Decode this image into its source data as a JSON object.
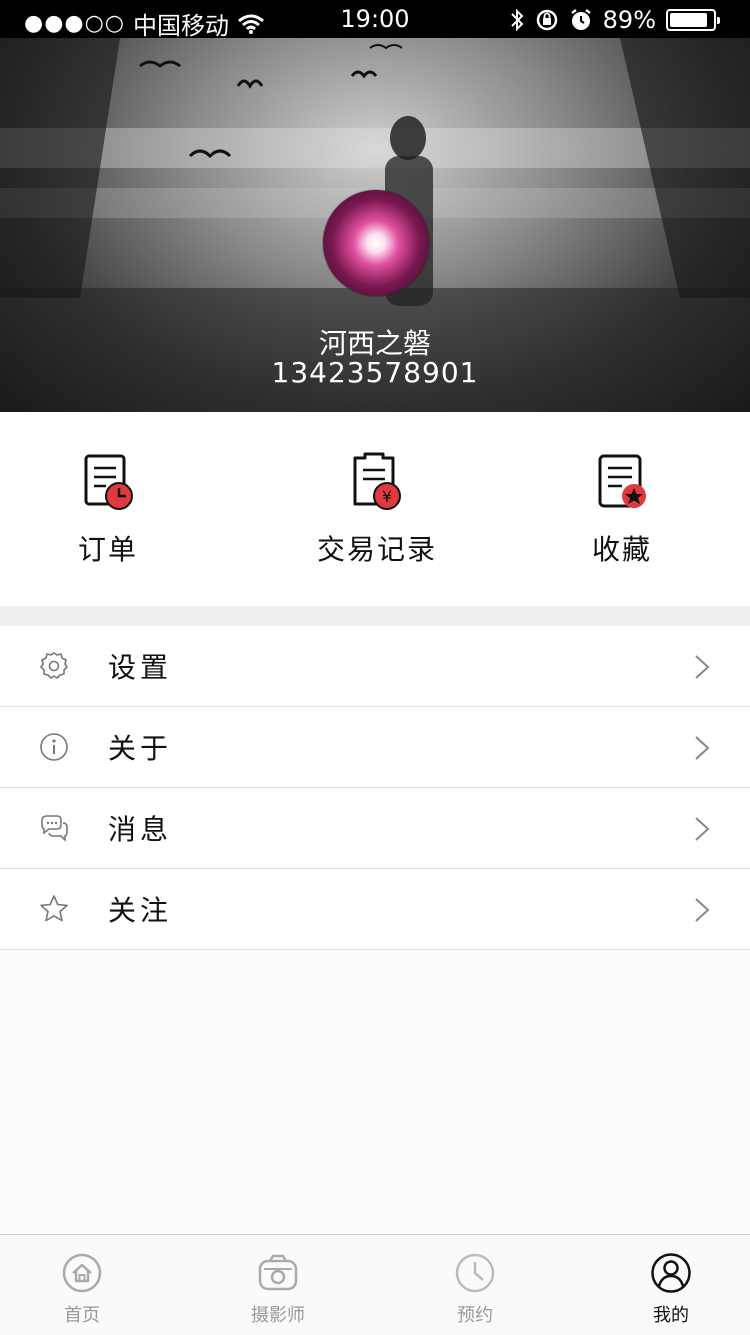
{
  "status_bar": {
    "signal": "●●●○○",
    "carrier": "中国移动",
    "time": "19:00",
    "battery_percent": "89%",
    "battery_level": 0.89
  },
  "profile": {
    "username": "河西之磐",
    "phone": "13423578901"
  },
  "quick_actions": [
    {
      "label": "订单",
      "icon": "order-clock-icon"
    },
    {
      "label": "交易记录",
      "icon": "transaction-yuan-icon"
    },
    {
      "label": "收藏",
      "icon": "favorite-star-icon"
    }
  ],
  "menu": [
    {
      "label": "设置",
      "icon": "gear-icon"
    },
    {
      "label": "关于",
      "icon": "info-icon"
    },
    {
      "label": "消息",
      "icon": "chat-icon"
    },
    {
      "label": "关注",
      "icon": "star-icon"
    }
  ],
  "tabs": [
    {
      "label": "首页",
      "icon": "home-icon",
      "active": false
    },
    {
      "label": "摄影师",
      "icon": "camera-icon",
      "active": false
    },
    {
      "label": "预约",
      "icon": "clock-icon",
      "active": false
    },
    {
      "label": "我的",
      "icon": "user-icon",
      "active": true
    }
  ],
  "colors": {
    "accent_red": "#e0393e",
    "text_dark": "#111111",
    "tab_inactive": "#999999"
  }
}
